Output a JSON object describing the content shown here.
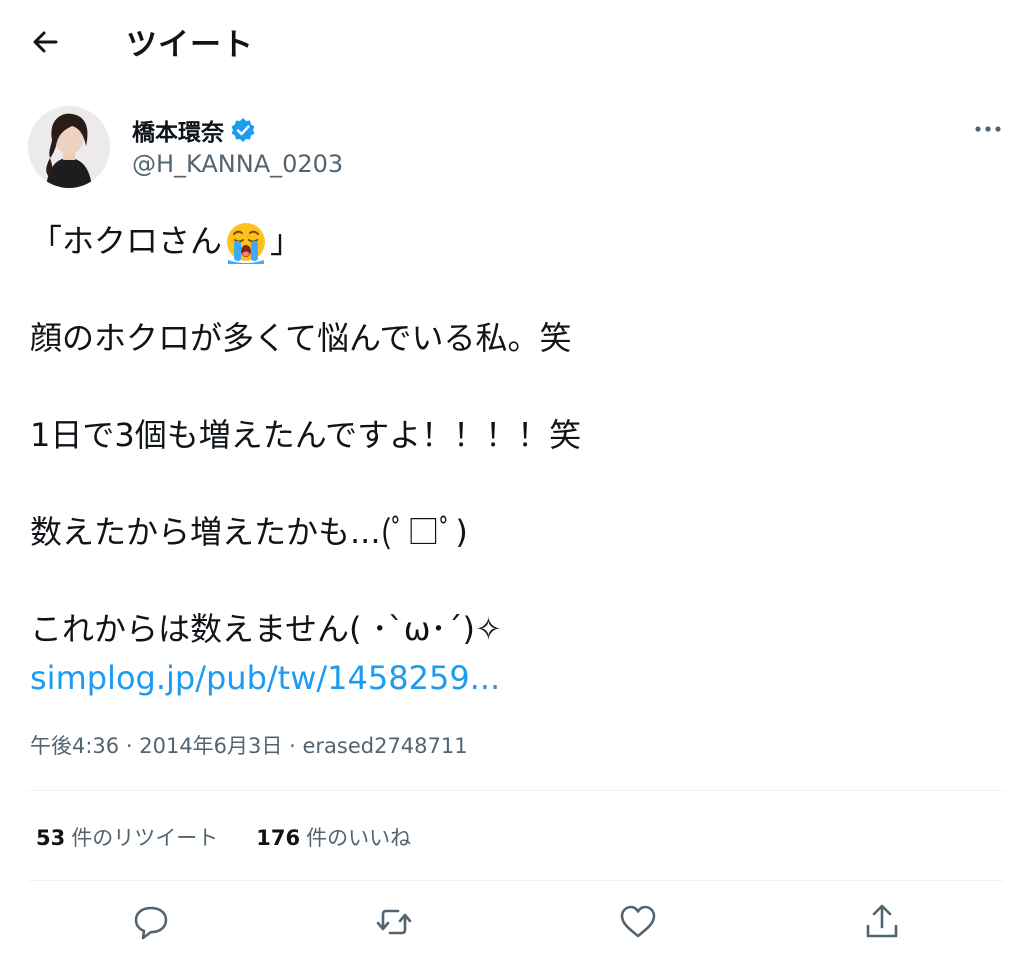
{
  "header": {
    "title": "ツイート"
  },
  "author": {
    "name": "橋本環奈",
    "handle": "@H_KANNA_0203"
  },
  "tweet": {
    "line1_before": "「ホクロさん",
    "line1_after": "」",
    "line2": "顔のホクロが多くて悩んでいる私。笑",
    "line3": "1日で3個も増えたんですよ！！！！笑",
    "line4": "数えたから増えたかも...(ﾟ□ﾟ)",
    "line5": "これからは数えません( ･`ω･´)✧",
    "link": "simplog.jp/pub/tw/1458259..."
  },
  "meta": {
    "time": "午後4:36",
    "date": "2014年6月3日",
    "source": "erased2748711",
    "separator": "·"
  },
  "stats": {
    "retweets_count": "53",
    "retweets_label": "件のリツイート",
    "likes_count": "176",
    "likes_label": "件のいいね"
  },
  "colors": {
    "link": "#1d9bf0",
    "secondary_text": "#536471",
    "verified": "#1d9bf0"
  },
  "icons": [
    "back-arrow-icon",
    "verified-badge-icon",
    "more-icon",
    "crying-face-icon",
    "reply-icon",
    "retweet-icon",
    "like-icon",
    "share-icon"
  ]
}
